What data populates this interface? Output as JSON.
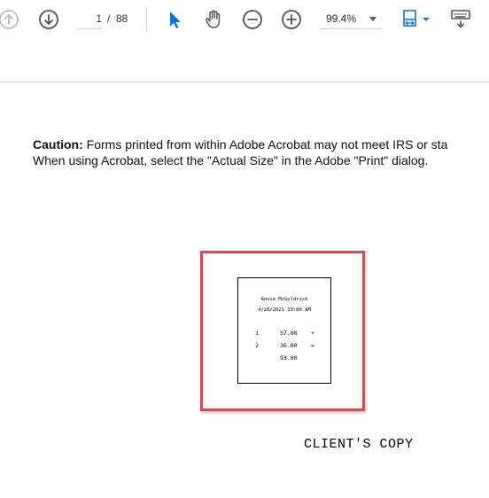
{
  "toolbar": {
    "page_current": "1",
    "page_separator": "/",
    "page_total": "88",
    "zoom": "99.4%"
  },
  "document": {
    "caution_label": "Caution:",
    "caution_line1": "Forms printed from within Adobe Acrobat may not meet IRS or sta",
    "caution_line2": "When using Acrobat, select the \"Actual Size\" in the Adobe \"Print\" dialog.",
    "receipt": {
      "name": "Annie McGoldrick",
      "datetime": "4/28/2021 10:00 AM",
      "rows": [
        {
          "index": "1",
          "amount": "57.00",
          "op": "+"
        },
        {
          "index": "2",
          "amount": "36.00",
          "op": "="
        },
        {
          "index": "",
          "amount": "93.00",
          "op": ""
        }
      ]
    },
    "copy_label": "CLIENT'S COPY"
  },
  "colors": {
    "accent_blue": "#1473e6",
    "highlight_red": "#e0484e",
    "icon_gray": "#555555",
    "icon_disabled": "#bdbdbd"
  },
  "icons": [
    "arrow-up-circle-icon",
    "arrow-down-circle-icon",
    "select-arrow-icon",
    "hand-icon",
    "zoom-out-icon",
    "zoom-in-icon",
    "fit-page-icon",
    "keyboard-icon"
  ]
}
